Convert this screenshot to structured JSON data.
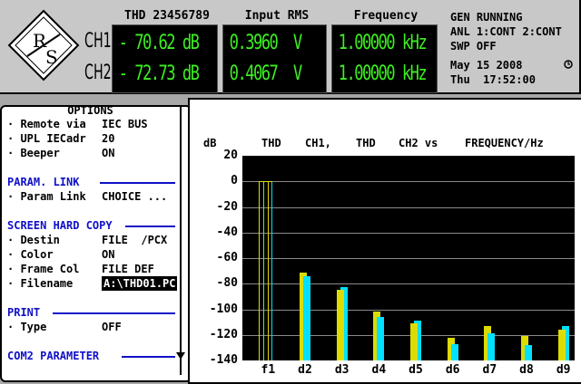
{
  "header": {
    "columns": [
      "THD 23456789",
      "Input RMS",
      "Frequency"
    ],
    "channels": [
      "CH1",
      "CH2"
    ],
    "readings": [
      [
        "- 70.62 dB",
        "0.3960  V",
        "1.00000 kHz"
      ],
      [
        "- 72.73 dB",
        "0.4067  V",
        "1.00000 kHz"
      ]
    ],
    "status_lines": [
      "GEN RUNNING",
      "ANL 1:CONT 2:CONT",
      "SWP OFF"
    ],
    "date": "May 15 2008",
    "time": "Thu  17:52:00",
    "clock_icon": "clock-icon"
  },
  "options": {
    "title": "OPTIONS",
    "rows": [
      {
        "label": "· Remote via",
        "value": "IEC BUS"
      },
      {
        "label": "· UPL IECadr",
        "value": "20"
      },
      {
        "label": "· Beeper",
        "value": "ON"
      }
    ],
    "param_link_head": "PARAM. LINK",
    "param_link_row": {
      "label": "· Param Link",
      "value": "CHOICE ..."
    },
    "hardcopy_head": "SCREEN HARD COPY",
    "hardcopy_rows": [
      {
        "label": "· Destin",
        "value": "FILE  /PCX"
      },
      {
        "label": "· Color",
        "value": "ON"
      },
      {
        "label": "· Frame Col",
        "value": "FILE DEF"
      },
      {
        "label": "· Filename",
        "value": "A:\\THD01.PC"
      }
    ],
    "print_head": "PRINT",
    "print_row": {
      "label": "· Type",
      "value": "OFF"
    },
    "com2_head": "COM2 PARAMETER",
    "scroll_icon": "scroll-down-arrow-icon"
  },
  "graph_header": {
    "dB": "dB",
    "t1": "THD",
    "t2": "CH1,",
    "t3": "THD",
    "t4": "CH2 vs",
    "t5": "FREQUENCY/Hz"
  },
  "colors": {
    "plot_bg": "#000000",
    "ch1_bar": "#dcdc00",
    "ch2_bar": "#00e0ff",
    "ch1_mid": "#40ff40",
    "grid": "#8a8a8a"
  },
  "chart_data": {
    "type": "bar",
    "title": "THD CH1, THD CH2 vs FREQUENCY/Hz",
    "xlabel": "FREQUENCY/Hz",
    "ylabel": "dB",
    "ylim": [
      -140,
      20
    ],
    "yticks": [
      20,
      0,
      -20,
      -40,
      -60,
      -80,
      -100,
      -120,
      -140
    ],
    "categories": [
      "f1",
      "d2",
      "d3",
      "d4",
      "d5",
      "d6",
      "d7",
      "d8",
      "d9"
    ],
    "series": [
      {
        "name": "CH1",
        "values": [
          0,
          -71,
          -85,
          -102,
          -111,
          -122,
          -113,
          -121,
          -116
        ]
      },
      {
        "name": "CH2",
        "values": [
          0,
          -74,
          -83,
          -106,
          -109,
          -127,
          -119,
          -128,
          -113
        ]
      }
    ],
    "grid": true
  }
}
